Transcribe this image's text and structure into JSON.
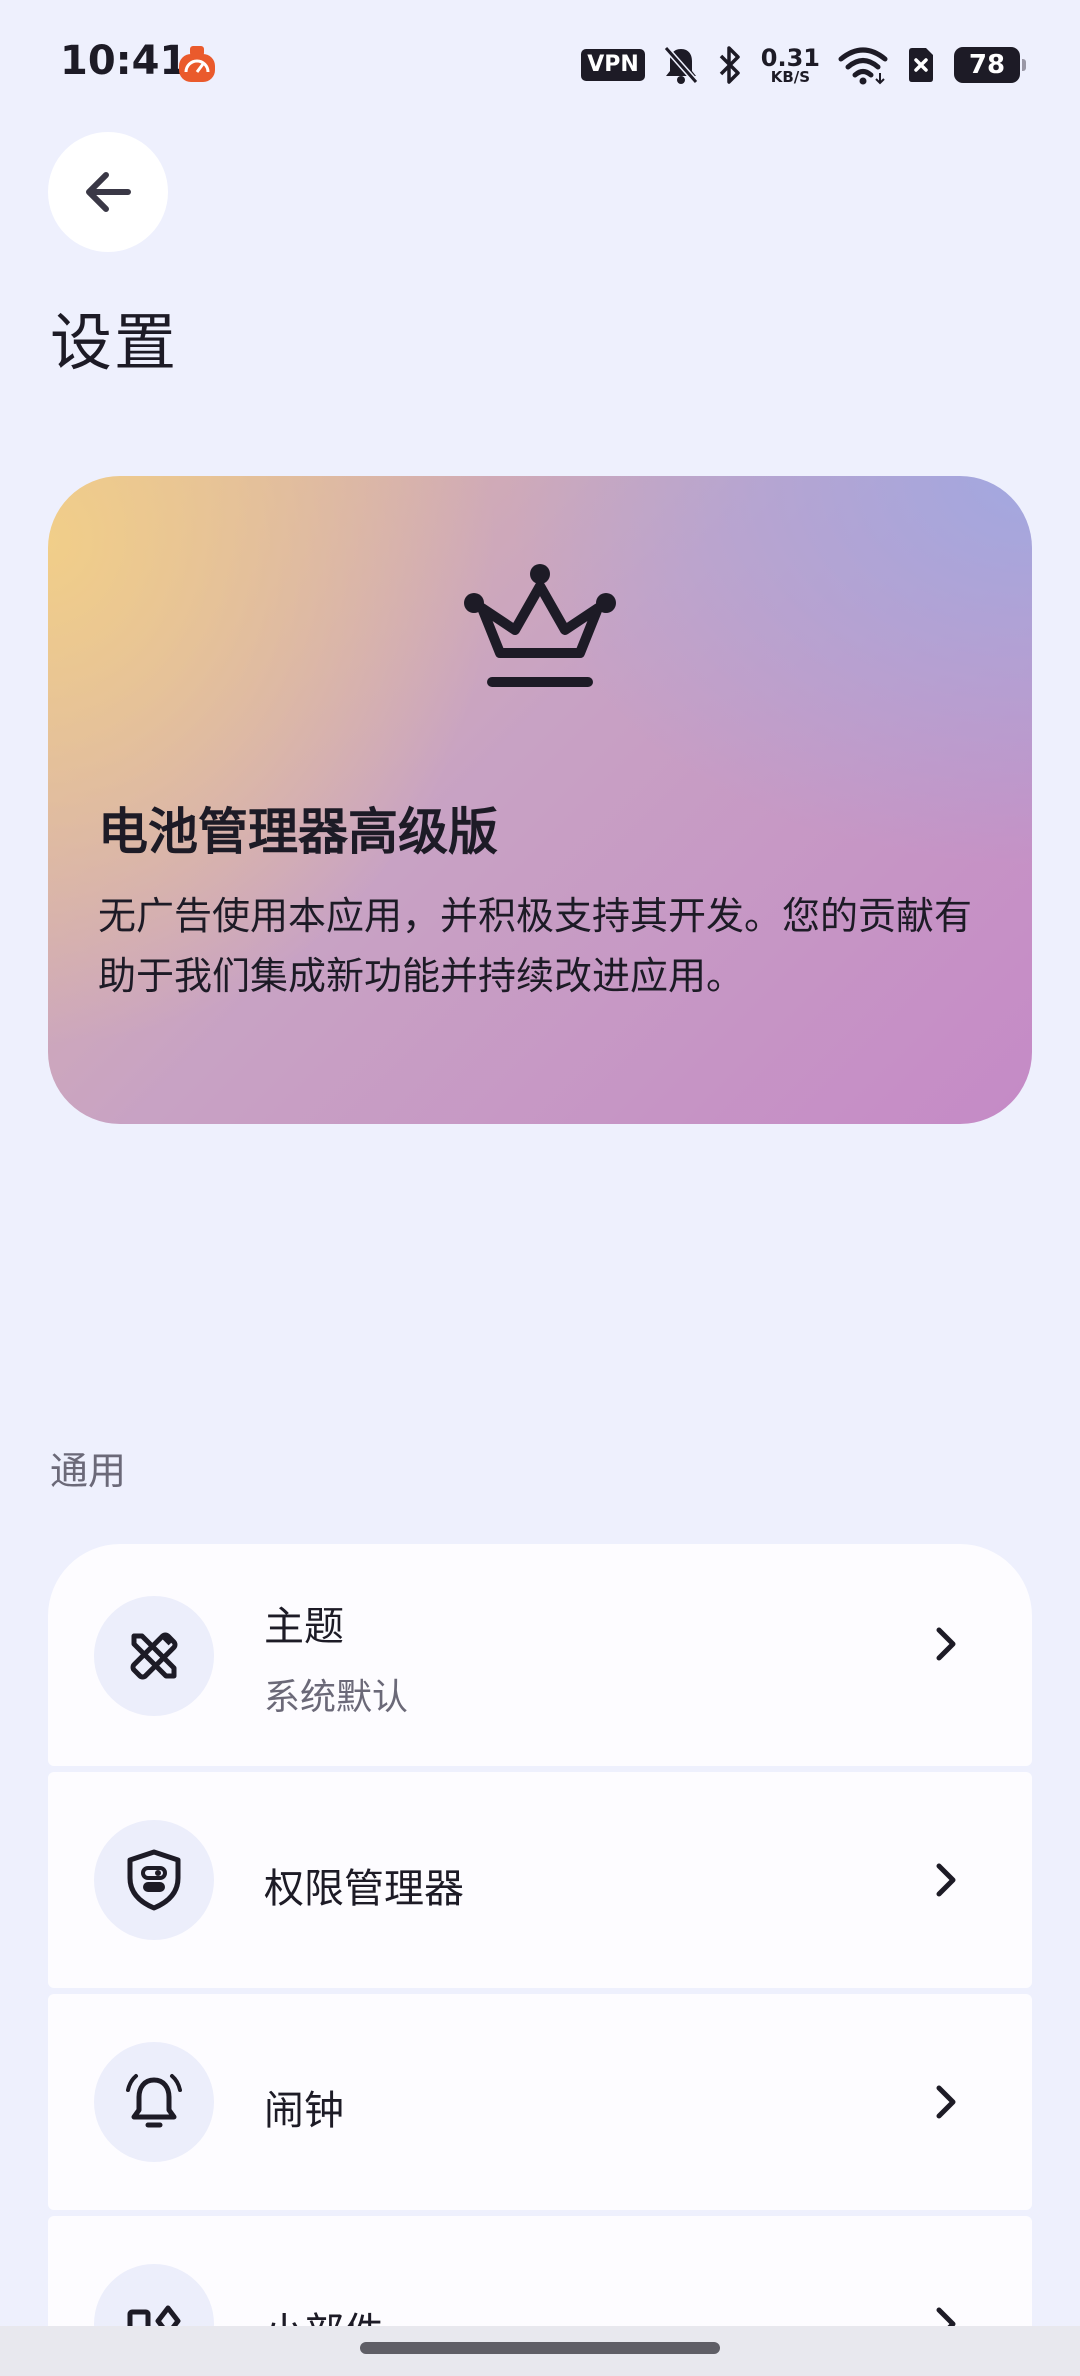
{
  "status_bar": {
    "time": "10:41",
    "vpn": "VPN",
    "net_speed_value": "0.31",
    "net_speed_unit": "KB/S",
    "battery": "78",
    "icons": [
      "app-notification-icon",
      "mute-bell-icon",
      "bluetooth-icon",
      "wifi-icon",
      "sim-off-icon"
    ]
  },
  "header": {
    "title": "设置",
    "back_icon": "arrow-left-icon"
  },
  "premium": {
    "icon": "crown-icon",
    "title": "电池管理器高级版",
    "description": "无广告使用本应用，并积极支持其开发。您的贡献有助于我们集成新功能并持续改进应用。",
    "gradient_colors": [
      "#f1ce89",
      "#a2a8e0",
      "#c58ac6"
    ]
  },
  "section": {
    "label": "通用"
  },
  "items": [
    {
      "label": "主题",
      "sublabel": "系统默认",
      "icon": "design-tools-icon"
    },
    {
      "label": "权限管理器",
      "icon": "shield-toggle-icon"
    },
    {
      "label": "闹钟",
      "icon": "alarm-bell-icon"
    },
    {
      "label": "小部件",
      "icon": "widgets-icon"
    }
  ],
  "colors": {
    "background": "#eef0fd",
    "card": "#fdfcff",
    "icon_circle": "#eceefb",
    "text_primary": "#1d1b26",
    "text_secondary": "#6b6978"
  }
}
